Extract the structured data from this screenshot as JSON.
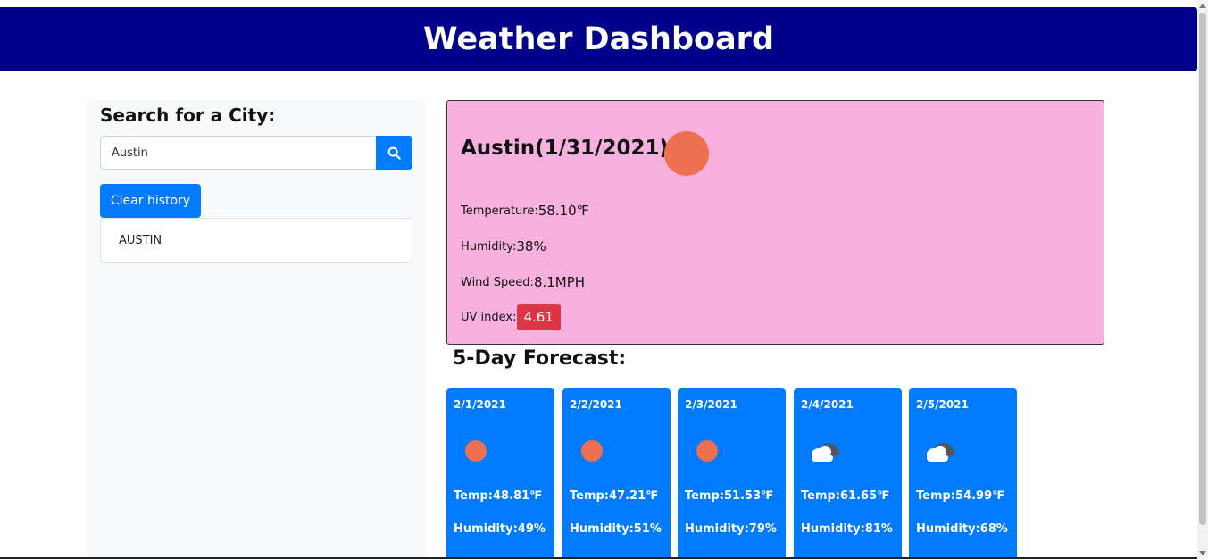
{
  "header": {
    "title": "Weather Dashboard"
  },
  "sidebar": {
    "heading": "Search for a City:",
    "search_value": "Austin",
    "search_icon": "search-icon",
    "clear_label": "Clear history",
    "history": [
      "AUSTIN"
    ]
  },
  "current": {
    "title": "Austin(1/31/2021)",
    "icon": "sun-icon",
    "temp_label": "Temperature:",
    "temp_value": "58.10℉",
    "humidity_label": "Humidity:",
    "humidity_value": "38%",
    "wind_label": "Wind Speed:",
    "wind_value": "8.1MPH",
    "uv_label": "UV index:",
    "uv_value": "4.61"
  },
  "forecast": {
    "heading": "5-Day Forecast:",
    "days": [
      {
        "date": "2/1/2021",
        "icon": "sun-icon",
        "temp": "Temp:48.81℉",
        "humidity": "Humidity:49%"
      },
      {
        "date": "2/2/2021",
        "icon": "sun-icon",
        "temp": "Temp:47.21℉",
        "humidity": "Humidity:51%"
      },
      {
        "date": "2/3/2021",
        "icon": "sun-icon",
        "temp": "Temp:51.53℉",
        "humidity": "Humidity:79%"
      },
      {
        "date": "2/4/2021",
        "icon": "cloud-icon",
        "temp": "Temp:61.65℉",
        "humidity": "Humidity:81%"
      },
      {
        "date": "2/5/2021",
        "icon": "cloud-icon",
        "temp": "Temp:54.99℉",
        "humidity": "Humidity:68%"
      }
    ]
  },
  "colors": {
    "header_bg": "#00008b",
    "accent": "#007bff",
    "current_bg": "#f8b0df",
    "uv_badge": "#dc3545",
    "sun": "#ee7050"
  }
}
